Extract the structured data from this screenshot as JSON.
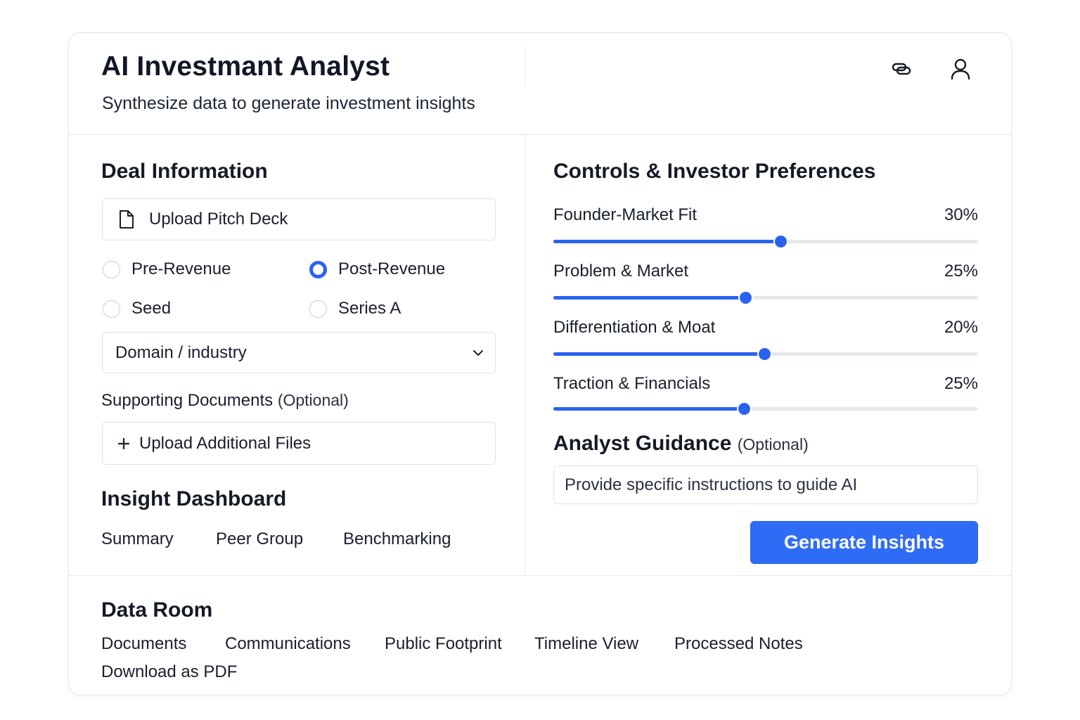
{
  "header": {
    "title": "AI Investmant Analyst",
    "subtitle": "Synthesize data to generate investment insights",
    "icons": [
      "link-icon",
      "user-icon"
    ]
  },
  "deal": {
    "title": "Deal Information",
    "upload_pitch_deck": "Upload Pitch Deck",
    "stages": [
      {
        "label": "Pre-Revenue",
        "checked": false
      },
      {
        "label": "Post-Revenue",
        "checked": true
      },
      {
        "label": "Seed",
        "checked": false
      },
      {
        "label": "Series A",
        "checked": false
      }
    ],
    "domain_select": "Domain / industry",
    "supporting_label": "Supporting Documents",
    "supporting_optional": "(Optional)",
    "upload_additional": "Upload Additional Files"
  },
  "insight": {
    "title": "Insight Dashboard",
    "tabs": [
      "Summary",
      "Peer Group",
      "Benchmarking"
    ]
  },
  "controls": {
    "title": "Controls & Investor Preferences",
    "sliders": [
      {
        "label": "Founder-Market Fit",
        "value_text": "30%",
        "position": 0.535
      },
      {
        "label": "Problem & Market",
        "value_text": "25%",
        "position": 0.452
      },
      {
        "label": "Differentiation & Moat",
        "value_text": "20%",
        "position": 0.497
      },
      {
        "label": "Traction & Financials",
        "value_text": "25%",
        "position": 0.448
      }
    ]
  },
  "guidance": {
    "title": "Analyst Guidance",
    "optional": "(Optional)",
    "placeholder": "Provide specific instructions to guide AI"
  },
  "generate_button": "Generate Insights",
  "data_room": {
    "title": "Data Room",
    "links": [
      "Documents",
      "Communications",
      "Public Footprint",
      "Timeline View",
      "Processed Notes",
      "Download as PDF"
    ]
  },
  "colors": {
    "accent": "#2f6cf6",
    "border": "#e4e7ec",
    "text": "#151a26"
  }
}
